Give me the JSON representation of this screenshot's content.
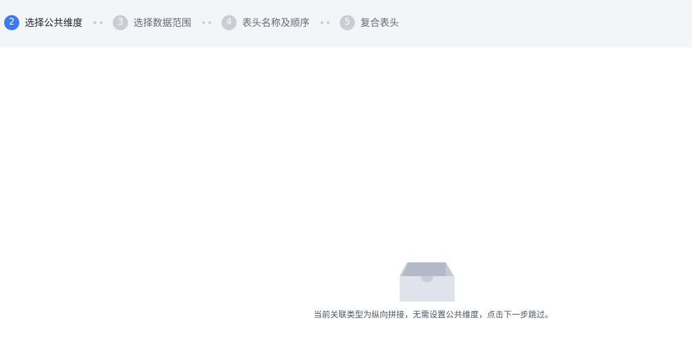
{
  "steps": [
    {
      "number": "2",
      "label": "选择公共维度",
      "state": "active"
    },
    {
      "number": "3",
      "label": "选择数据范围",
      "state": "inactive"
    },
    {
      "number": "4",
      "label": "表头名称及顺序",
      "state": "inactive"
    },
    {
      "number": "5",
      "label": "复合表头",
      "state": "inactive"
    }
  ],
  "colors": {
    "active_step": "#3d7af0",
    "inactive_step": "#c8cdd6",
    "stepbar_bg": "#f4f5f8"
  },
  "empty_state": {
    "icon": "empty-box-icon",
    "message": "当前关联类型为纵向拼接，无需设置公共维度，点击下一步跳过。"
  }
}
